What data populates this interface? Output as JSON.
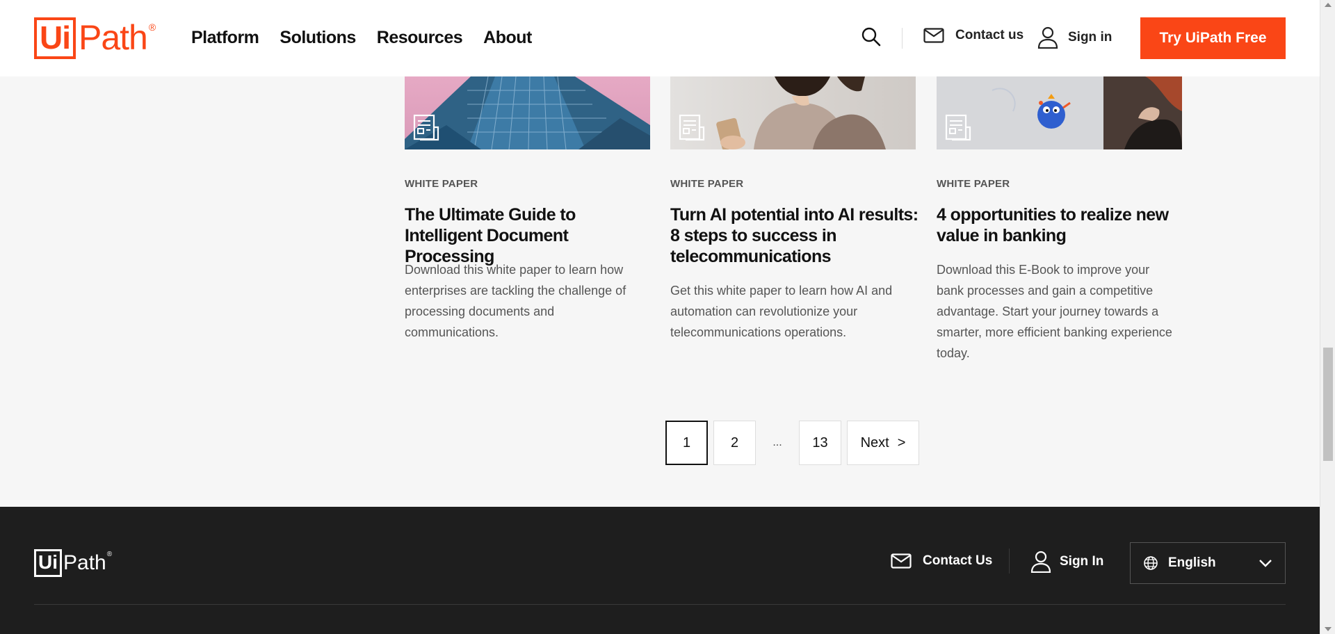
{
  "header": {
    "logo_box": "Ui",
    "logo_rest": "Path",
    "logo_reg": "®",
    "nav": [
      "Platform",
      "Solutions",
      "Resources",
      "About"
    ],
    "contact_label": "Contact us",
    "signin_label": "Sign in",
    "cta_label": "Try UiPath Free",
    "brand_color": "#fa4616"
  },
  "cards": [
    {
      "tag": "WHITE PAPER",
      "title": "The Ultimate Guide to Intelligent Document Processing",
      "description": "Download this white paper to learn how enterprises are tackling the challenge of processing documents and communications."
    },
    {
      "tag": "WHITE PAPER",
      "title": "Turn AI potential into AI results: 8 steps to success in telecommunications",
      "description": "Get this white paper to learn how AI and automation can revolutionize your telecommunications operations."
    },
    {
      "tag": "WHITE PAPER",
      "title": "4 opportunities to realize new value in banking",
      "description": "Download this E-Book to improve your bank processes and gain a competitive advantage. Start your journey towards a smarter, more efficient banking experience today."
    }
  ],
  "pagination": {
    "current": "1",
    "page2": "2",
    "ellipsis": "...",
    "last": "13",
    "next_label": "Next",
    "next_arrow": ">"
  },
  "footer": {
    "logo_box": "Ui",
    "logo_rest": "Path",
    "logo_reg": "®",
    "contact_label": "Contact Us",
    "signin_label": "Sign In",
    "language": "English"
  }
}
